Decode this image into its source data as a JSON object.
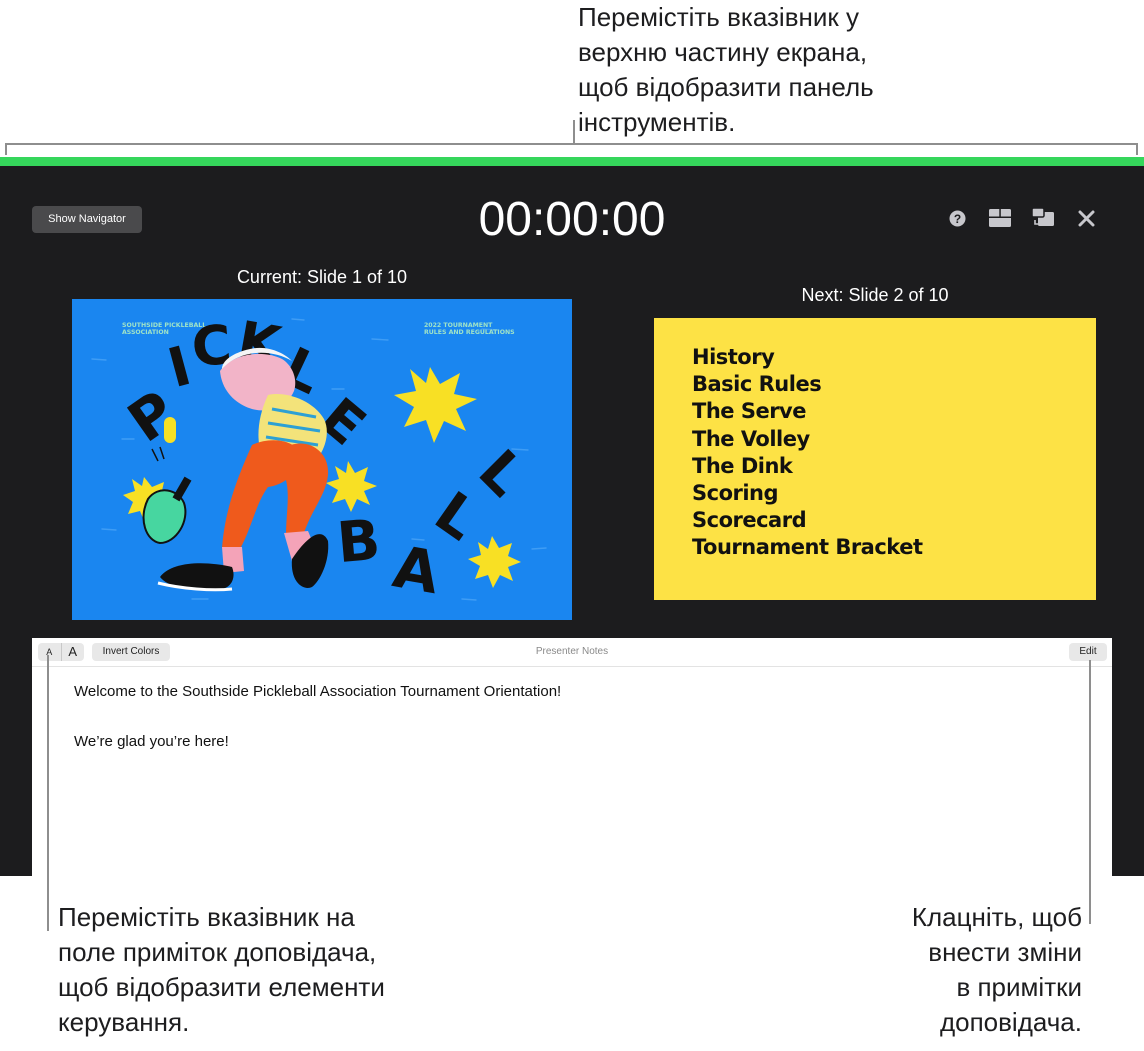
{
  "callouts": {
    "toolbar": "Перемістіть вказівник у\nверхню частину екрана,\nщоб відобразити панель\nінструментів.",
    "notes_controls": "Перемістіть вказівник на\nполе приміток доповідача,\nщоб відобразити елементи\nкерування.",
    "edit": "Клацніть, щоб\nвнести зміни\nв примітки\nдоповідача."
  },
  "toolbar": {
    "show_navigator": "Show Navigator",
    "timer": "00:00:00",
    "icons": [
      "help-icon",
      "layout-icon",
      "swap-displays-icon",
      "close-icon"
    ]
  },
  "current_slide": {
    "label": "Current: Slide 1 of 10",
    "left_caption": "SOUTHSIDE PICKLEBALL\nASSOCIATION",
    "right_caption": "2022 TOURNAMENT\nRULES AND REGULATIONS",
    "word1": "PICKLE",
    "word2": "BALL"
  },
  "next_slide": {
    "label": "Next: Slide 2 of 10",
    "items": [
      "History",
      "Basic Rules",
      "The Serve",
      "The Volley",
      "The Dink",
      "Scoring",
      "Scorecard",
      "Tournament Bracket"
    ]
  },
  "notes": {
    "font_small": "A",
    "font_large": "A",
    "invert": "Invert Colors",
    "title": "Presenter Notes",
    "edit": "Edit",
    "line1": "Welcome to the Southside Pickleball Association Tournament Orientation!",
    "line2": "We’re glad you’re here!"
  },
  "colors": {
    "accent_green": "#35d65b",
    "window_bg": "#1c1c1e",
    "slide_blue": "#1a86f0",
    "slide_yellow": "#fde245"
  }
}
